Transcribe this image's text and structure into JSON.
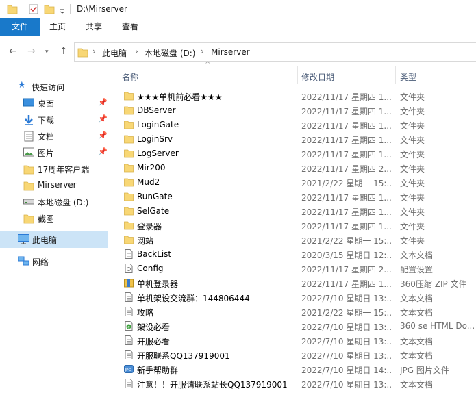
{
  "window": {
    "title": "D:\\Mirserver"
  },
  "ribbon": {
    "tabs": [
      "文件",
      "主页",
      "共享",
      "查看"
    ]
  },
  "address": {
    "crumbs": [
      "此电脑",
      "本地磁盘 (D:)",
      "Mirserver"
    ]
  },
  "sidebar": {
    "items": [
      {
        "label": "快速访问",
        "icon": "star-icon"
      },
      {
        "label": "桌面",
        "icon": "desktop-icon",
        "pinned": true
      },
      {
        "label": "下载",
        "icon": "download-icon",
        "pinned": true
      },
      {
        "label": "文档",
        "icon": "document-icon",
        "pinned": true
      },
      {
        "label": "图片",
        "icon": "picture-icon",
        "pinned": true
      },
      {
        "label": "17周年客户端",
        "icon": "folder-icon"
      },
      {
        "label": "Mirserver",
        "icon": "folder-icon"
      },
      {
        "label": "本地磁盘 (D:)",
        "icon": "drive-icon"
      },
      {
        "label": "截图",
        "icon": "folder-icon"
      },
      {
        "label": "此电脑",
        "icon": "computer-icon",
        "selected": true
      },
      {
        "label": "网络",
        "icon": "network-icon"
      }
    ]
  },
  "columns": {
    "name": "名称",
    "date": "修改日期",
    "type": "类型"
  },
  "files": [
    {
      "name": "★★★单机前必看★★★",
      "date": "2022/11/17 星期四 1...",
      "type": "文件夹",
      "icon": "folder-icon"
    },
    {
      "name": "DBServer",
      "date": "2022/11/17 星期四 1...",
      "type": "文件夹",
      "icon": "folder-icon"
    },
    {
      "name": "LoginGate",
      "date": "2022/11/17 星期四 1...",
      "type": "文件夹",
      "icon": "folder-icon"
    },
    {
      "name": "LoginSrv",
      "date": "2022/11/17 星期四 1...",
      "type": "文件夹",
      "icon": "folder-icon"
    },
    {
      "name": "LogServer",
      "date": "2022/11/17 星期四 1...",
      "type": "文件夹",
      "icon": "folder-icon"
    },
    {
      "name": "Mir200",
      "date": "2022/11/17 星期四 2...",
      "type": "文件夹",
      "icon": "folder-icon"
    },
    {
      "name": "Mud2",
      "date": "2021/2/22 星期一 15:...",
      "type": "文件夹",
      "icon": "folder-icon"
    },
    {
      "name": "RunGate",
      "date": "2022/11/17 星期四 1...",
      "type": "文件夹",
      "icon": "folder-icon"
    },
    {
      "name": "SelGate",
      "date": "2022/11/17 星期四 1...",
      "type": "文件夹",
      "icon": "folder-icon"
    },
    {
      "name": "登录器",
      "date": "2022/11/17 星期四 1...",
      "type": "文件夹",
      "icon": "folder-icon"
    },
    {
      "name": "网站",
      "date": "2021/2/22 星期一 15:...",
      "type": "文件夹",
      "icon": "folder-icon"
    },
    {
      "name": "BackList",
      "date": "2020/3/15 星期日 12:...",
      "type": "文本文档",
      "icon": "text-file-icon"
    },
    {
      "name": "Config",
      "date": "2022/11/17 星期四 2...",
      "type": "配置设置",
      "icon": "config-file-icon"
    },
    {
      "name": "单机登录器",
      "date": "2022/11/17 星期四 1...",
      "type": "360压缩 ZIP 文件",
      "icon": "zip-file-icon"
    },
    {
      "name": "单机架设交流群：144806444",
      "date": "2022/7/10 星期日 13:...",
      "type": "文本文档",
      "icon": "text-file-icon"
    },
    {
      "name": "攻略",
      "date": "2021/2/22 星期一 15:...",
      "type": "文本文档",
      "icon": "text-file-icon"
    },
    {
      "name": "架设必看",
      "date": "2022/7/10 星期日 13:...",
      "type": "360 se HTML Do...",
      "icon": "html-file-icon"
    },
    {
      "name": "开服必看",
      "date": "2022/7/10 星期日 13:...",
      "type": "文本文档",
      "icon": "text-file-icon"
    },
    {
      "name": "开服联系QQ137919001",
      "date": "2022/7/10 星期日 13:...",
      "type": "文本文档",
      "icon": "text-file-icon"
    },
    {
      "name": "新手帮助群",
      "date": "2022/7/10 星期日 14:...",
      "type": "JPG 图片文件",
      "icon": "jpg-file-icon"
    },
    {
      "name": "注意！！开服请联系站长QQ137919001",
      "date": "2022/7/10 星期日 13:...",
      "type": "文本文档",
      "icon": "text-file-icon"
    }
  ],
  "colors": {
    "accent": "#1979ca",
    "folder": "#f8d775",
    "selected": "#cce4f7"
  }
}
